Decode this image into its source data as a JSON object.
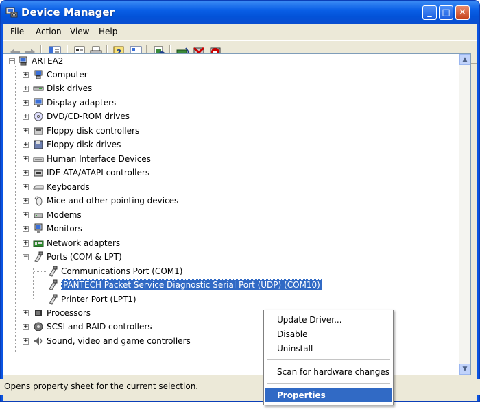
{
  "window": {
    "title": "Device Manager"
  },
  "menu": [
    "File",
    "Action",
    "View",
    "Help"
  ],
  "toolbar_icons": [
    "back-arrow-icon",
    "forward-arrow-icon",
    "show-hide-tree-icon",
    "properties-icon",
    "print-icon",
    "help-icon",
    "device-list-icon",
    "scan-hardware-icon",
    "update-driver-icon",
    "disable-device-icon",
    "uninstall-device-icon"
  ],
  "tree": {
    "root": "ARTEA2",
    "categories": [
      "Computer",
      "Disk drives",
      "Display adapters",
      "DVD/CD-ROM drives",
      "Floppy disk controllers",
      "Floppy disk drives",
      "Human Interface Devices",
      "IDE ATA/ATAPI controllers",
      "Keyboards",
      "Mice and other pointing devices",
      "Modems",
      "Monitors",
      "Network adapters",
      "Ports (COM & LPT)"
    ],
    "ports_children": [
      "Communications Port (COM1)",
      "PANTECH Packet Service Diagnostic Serial Port (UDP) (COM10)",
      "Printer Port (LPT1)"
    ],
    "after_categories": [
      "Processors",
      "SCSI and RAID controllers",
      "Sound, video and game controllers"
    ]
  },
  "context_menu": {
    "items": [
      "Update Driver...",
      "Disable",
      "Uninstall",
      "Scan for hardware changes",
      "Properties"
    ]
  },
  "status": "Opens property sheet for the current selection.",
  "colors": {
    "title_bar": "#0a5fe6",
    "selection": "#316ac5",
    "client": "#ece9d8"
  }
}
